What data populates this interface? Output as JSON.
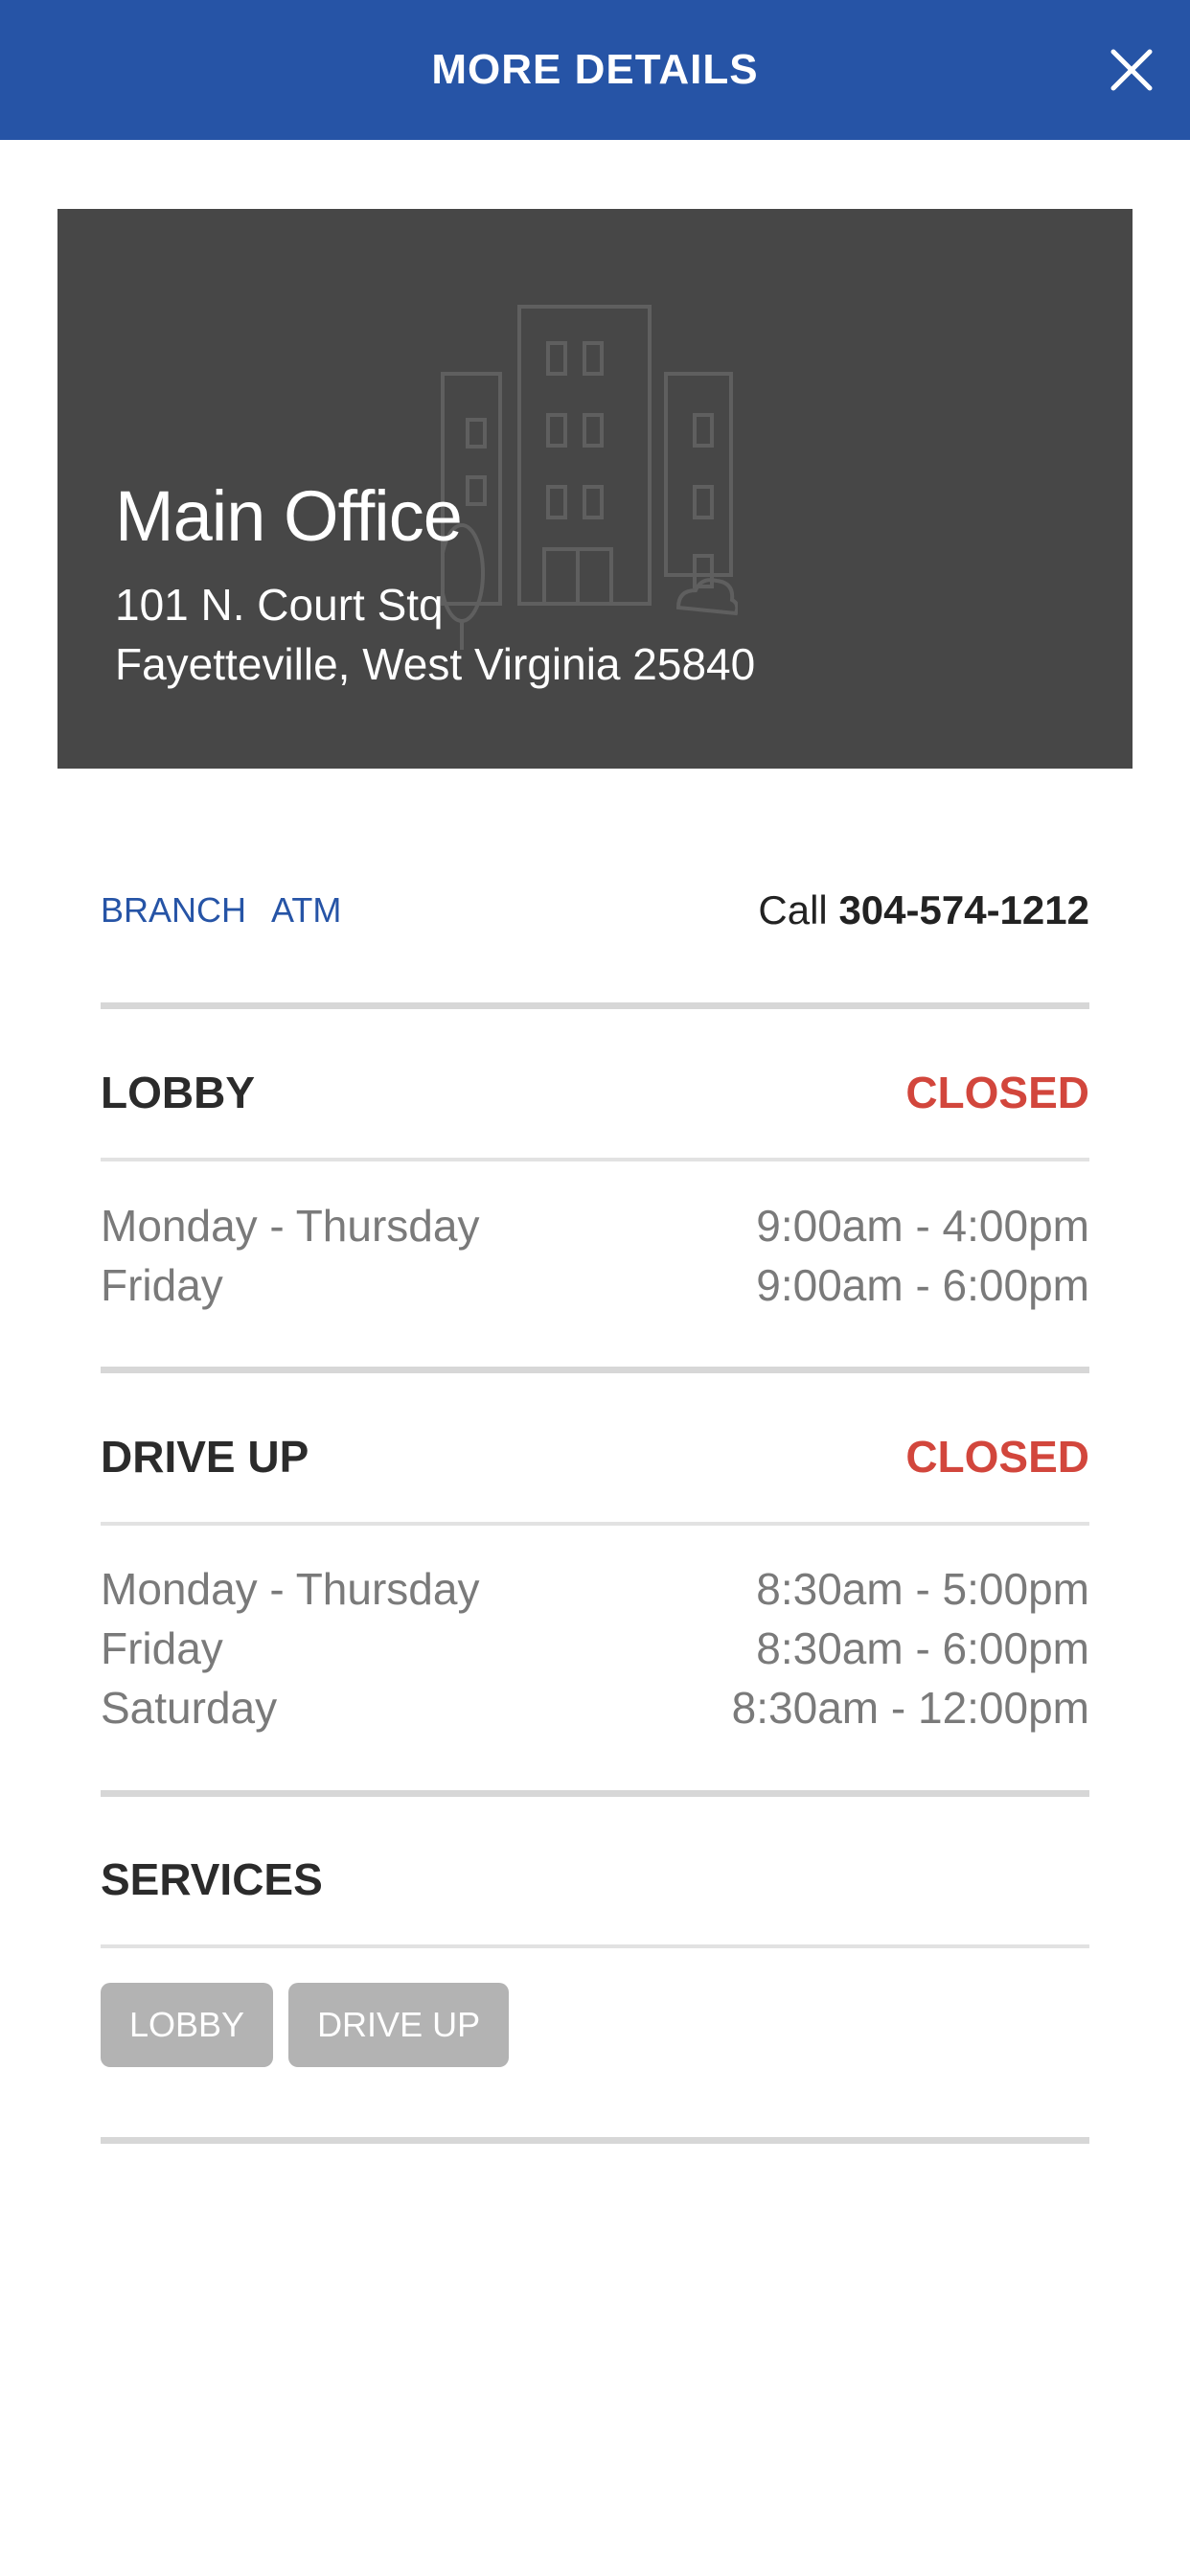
{
  "header": {
    "title": "MORE DETAILS",
    "close_icon": "close-icon"
  },
  "hero": {
    "illustration_icon": "building-icon",
    "name": "Main Office",
    "address_line1": "101 N. Court Stq",
    "address_line2": "Fayetteville, West Virginia 25840"
  },
  "tags": [
    "BRANCH",
    "ATM"
  ],
  "phone": {
    "prefix": "Call",
    "number": "304-574-1212"
  },
  "lobby": {
    "title": "LOBBY",
    "status": "CLOSED",
    "hours": [
      {
        "days": "Monday - Thursday",
        "time": "9:00am - 4:00pm"
      },
      {
        "days": "Friday",
        "time": "9:00am - 6:00pm"
      }
    ]
  },
  "drive_up": {
    "title": "DRIVE UP",
    "status": "CLOSED",
    "hours": [
      {
        "days": "Monday - Thursday",
        "time": "8:30am - 5:00pm"
      },
      {
        "days": "Friday",
        "time": "8:30am - 6:00pm"
      },
      {
        "days": "Saturday",
        "time": "8:30am - 12:00pm"
      }
    ]
  },
  "services": {
    "title": "SERVICES",
    "chips": [
      "LOBBY",
      "DRIVE UP"
    ]
  },
  "colors": {
    "header_bg": "#2654a6",
    "hero_bg": "#474747",
    "closed": "#d2463c",
    "chip_bg": "#b3b3b3"
  }
}
